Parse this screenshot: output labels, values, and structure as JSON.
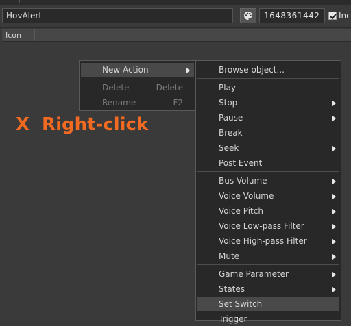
{
  "toolbar": {
    "name_value": "HovAlert",
    "id_value": "1648361442",
    "include_label": "Incl",
    "include_checked": true,
    "color_icon": "palette-icon"
  },
  "list": {
    "columns": [
      "Icon"
    ]
  },
  "annotation": {
    "x": "X",
    "text": "Right-click",
    "color": "#f26a21"
  },
  "context_menu": {
    "items": [
      {
        "label": "New Action",
        "submenu": true,
        "highlighted": true
      },
      {
        "label": "Delete",
        "shortcut": "Delete",
        "enabled": false
      },
      {
        "label": "Rename",
        "shortcut": "F2",
        "enabled": false
      }
    ]
  },
  "submenu": {
    "items": [
      {
        "label": "Browse object...",
        "submenu": false
      },
      {
        "label": "Play",
        "submenu": false
      },
      {
        "label": "Stop",
        "submenu": true
      },
      {
        "label": "Pause",
        "submenu": true
      },
      {
        "label": "Break",
        "submenu": false
      },
      {
        "label": "Seek",
        "submenu": true
      },
      {
        "label": "Post Event",
        "submenu": false
      },
      {
        "label": "Bus Volume",
        "submenu": true
      },
      {
        "label": "Voice Volume",
        "submenu": true
      },
      {
        "label": "Voice Pitch",
        "submenu": true
      },
      {
        "label": "Voice Low-pass Filter",
        "submenu": true
      },
      {
        "label": "Voice High-pass Filter",
        "submenu": true
      },
      {
        "label": "Mute",
        "submenu": true
      },
      {
        "label": "Game Parameter",
        "submenu": true
      },
      {
        "label": "States",
        "submenu": true
      },
      {
        "label": "Set Switch",
        "submenu": false,
        "highlighted": true
      },
      {
        "label": "Trigger",
        "submenu": false
      }
    ]
  }
}
